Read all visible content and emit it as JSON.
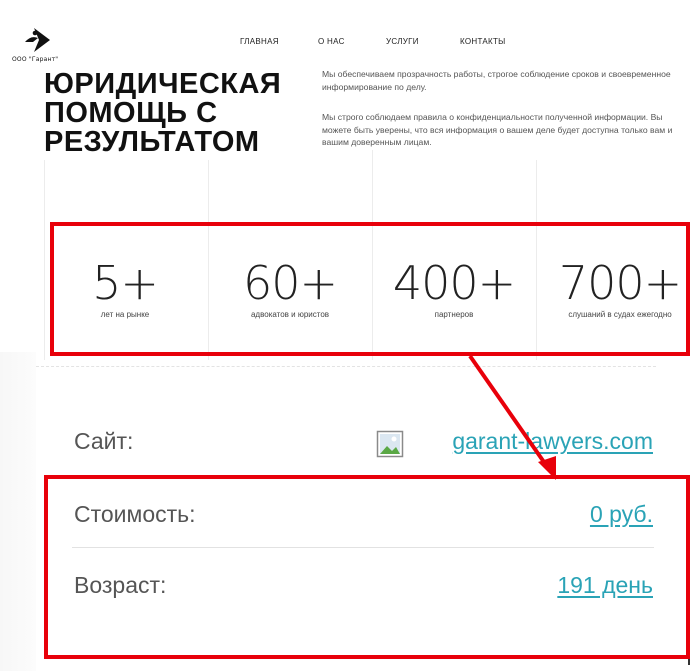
{
  "header": {
    "company": "ООО \"Гарант\"",
    "nav": [
      "ГЛАВНАЯ",
      "О НАС",
      "УСЛУГИ",
      "КОНТАКТЫ"
    ]
  },
  "hero": {
    "title_lines": [
      "ЮРИДИЧЕСКАЯ",
      "ПОМОЩЬ С",
      "РЕЗУЛЬТАТОМ"
    ],
    "paragraph1": "Мы обеспечиваем прозрачность работы, строгое соблюдение сроков и своевременное информирование по делу.",
    "paragraph2": "Мы строго соблюдаем правила о конфиденциальности полученной информации. Вы можете быть уверены, что вся информация о вашем деле будет доступна только вам и вашим доверенным лицам."
  },
  "stats": [
    {
      "value": "5+",
      "label": "лет на рынке"
    },
    {
      "value": "60+",
      "label": "адвокатов и юристов"
    },
    {
      "value": "400+",
      "label": "партнеров"
    },
    {
      "value": "700+",
      "label": "слушаний в судах ежегодно"
    }
  ],
  "info": {
    "site_label": "Сайт:",
    "site_value": "garant-lawyers.com",
    "cost_label": "Стоимость:",
    "cost_value": "0 руб.",
    "age_label": "Возраст:",
    "age_value": "191 день"
  },
  "colors": {
    "highlight": "#e8000a",
    "link": "#2aa3b6"
  }
}
